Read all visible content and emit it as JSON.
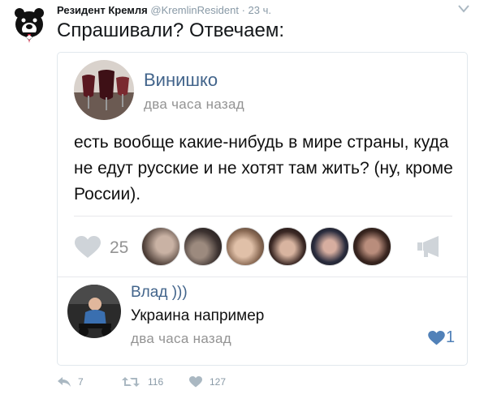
{
  "tweet": {
    "author_name": "Резидент Кремля",
    "handle": "@KremlinResident",
    "separator": "·",
    "time": "23 ч.",
    "text": "Спрашивали? Отвечаем:",
    "avatar_icon": "bear-icon",
    "menu_icon": "chevron-down-icon"
  },
  "post": {
    "author": "Винишко",
    "time": "два часа назад",
    "text": "есть вообще какие-нибудь в мире страны, куда не едут русские и не хотят там жить? (ну, кроме России).",
    "likes": "25",
    "like_icon": "heart-icon",
    "share_icon": "megaphone-icon",
    "liker_count": 6
  },
  "comment": {
    "author": "Влад )))",
    "text": "Украина например",
    "time": "два часа назад",
    "likes": "1",
    "like_color": "#5181b8"
  },
  "actions": {
    "replies": "7",
    "retweets": "116",
    "likes": "127"
  },
  "colors": {
    "link": "#42648b",
    "muted": "#939393",
    "twitter_gray": "#8899a6",
    "heart_gray": "#cfd4d9",
    "vk_blue": "#5181b8"
  }
}
